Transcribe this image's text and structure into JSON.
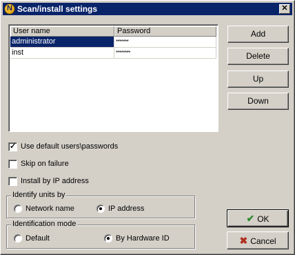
{
  "window": {
    "title": "Scan/install settings",
    "close_glyph": "✕"
  },
  "users_list": {
    "columns": [
      "User name",
      "Password"
    ],
    "rows": [
      {
        "user": "administrator",
        "password": "*******",
        "selected": true
      },
      {
        "user": "inst",
        "password": "********",
        "selected": false
      }
    ]
  },
  "side_buttons": {
    "add": "Add",
    "delete": "Delete",
    "up": "Up",
    "down": "Down"
  },
  "options": {
    "use_default": {
      "label": "Use default users\\passwords",
      "checked": true
    },
    "skip_on_failure": {
      "label": "Skip on failure",
      "checked": false
    },
    "install_by_ip": {
      "label": "Install by IP address",
      "checked": false
    }
  },
  "identify_units": {
    "title": "Identify units by",
    "network_name": "Network name",
    "ip_address": "IP address",
    "selected": "ip_address"
  },
  "identification_mode": {
    "title": "Identification mode",
    "default": "Default",
    "by_hardware_id": "By Hardware ID",
    "selected": "by_hardware_id"
  },
  "dialog_buttons": {
    "ok": "OK",
    "cancel": "Cancel",
    "ok_icon": "checkmark-icon",
    "cancel_icon": "cross-icon"
  }
}
